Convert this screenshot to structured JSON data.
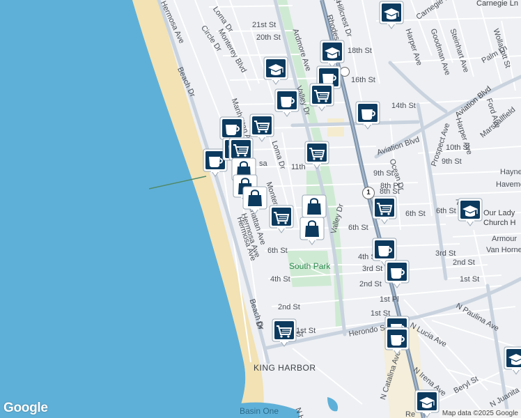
{
  "map": {
    "attribution": "Map data ©2025 Google",
    "logo": "Google",
    "colors": {
      "ocean": "#5fb0d8",
      "sand": "#f2e2b4",
      "land": "#eef0f3",
      "road_major": "#b7c6d8",
      "highway": "#7f95ad",
      "park": "#cfead3",
      "marker_fill": "#0c3a5e"
    },
    "labels": [
      {
        "text": "21st St"
      },
      {
        "text": "20th St"
      },
      {
        "text": "Loma Dr"
      },
      {
        "text": "Circle Dr"
      },
      {
        "text": "Monterey Blvd"
      },
      {
        "text": "Hermosa Ave"
      },
      {
        "text": "Beach Dr"
      },
      {
        "text": "Manhattan Ave"
      },
      {
        "text": "Ardmore Ave"
      },
      {
        "text": "Valley Dr"
      },
      {
        "text": "18th St"
      },
      {
        "text": "16th St"
      },
      {
        "text": "14th St"
      },
      {
        "text": "Rhodes St"
      },
      {
        "text": "Hillcrest Dr"
      },
      {
        "text": "21st St"
      },
      {
        "text": "Carnegie Ln"
      },
      {
        "text": "Carnegie Ln"
      },
      {
        "text": "Harper Ave"
      },
      {
        "text": "Goodman Ave"
      },
      {
        "text": "Steinhart Ave"
      },
      {
        "text": "Wollacott St"
      },
      {
        "text": "Palm Ln"
      },
      {
        "text": "Aviation Blvd"
      },
      {
        "text": "Ford Ave"
      },
      {
        "text": "Harper Ave"
      },
      {
        "text": "Marshallfield"
      },
      {
        "text": "Prospect Ave"
      },
      {
        "text": "10th St"
      },
      {
        "text": "9th St"
      },
      {
        "text": "Hayne"
      },
      {
        "text": "Havemeye"
      },
      {
        "text": "7th Pl"
      },
      {
        "text": "6th St"
      },
      {
        "text": "Our Lady"
      },
      {
        "text": "Church H"
      },
      {
        "text": "Armour"
      },
      {
        "text": "Van Horne"
      },
      {
        "text": "Aviation Blvd"
      },
      {
        "text": "Ocean Dr"
      },
      {
        "text": "9th St"
      },
      {
        "text": "8th Pl"
      },
      {
        "text": "8th St"
      },
      {
        "text": "11th"
      },
      {
        "text": "Loma Dr"
      },
      {
        "text": "Monterey Blvd"
      },
      {
        "text": "Manhattan Ave"
      },
      {
        "text": "Hermosa Ave"
      },
      {
        "text": "6th St"
      },
      {
        "text": "6th St"
      },
      {
        "text": "6th St"
      },
      {
        "text": "4th St"
      },
      {
        "text": "4th St"
      },
      {
        "text": "3rd St"
      },
      {
        "text": "3rd St"
      },
      {
        "text": "2nd St"
      },
      {
        "text": "2nd St"
      },
      {
        "text": "2nd St"
      },
      {
        "text": "1st St"
      },
      {
        "text": "1st Pl"
      },
      {
        "text": "1st St"
      },
      {
        "text": "1st St"
      },
      {
        "text": "Valley Dr"
      },
      {
        "text": "South Park"
      },
      {
        "text": "Beach Dr"
      },
      {
        "text": "Herondo St"
      },
      {
        "text": "N Paulina Ave"
      },
      {
        "text": "N Lucia Ave"
      },
      {
        "text": "N Irena Ave"
      },
      {
        "text": "N Juanita"
      },
      {
        "text": "Beryl St"
      },
      {
        "text": "N Catalina Ave"
      },
      {
        "text": "KING HARBOR"
      },
      {
        "text": "Basin One"
      },
      {
        "text": "N Ha"
      },
      {
        "text": "Hermosa Ave"
      },
      {
        "text": "sa"
      },
      {
        "text": "Re"
      },
      {
        "text": "Dr"
      },
      {
        "text": "St"
      }
    ],
    "markers": [
      {
        "kind": "school",
        "icon": "school-icon"
      },
      {
        "kind": "school",
        "icon": "school-icon"
      },
      {
        "kind": "school",
        "icon": "school-icon"
      },
      {
        "kind": "school",
        "icon": "school-icon"
      },
      {
        "kind": "school",
        "icon": "school-icon"
      },
      {
        "kind": "school",
        "icon": "school-icon"
      },
      {
        "kind": "cafe",
        "icon": "coffee-cup-icon"
      },
      {
        "kind": "cafe",
        "icon": "coffee-cup-icon"
      },
      {
        "kind": "cafe",
        "icon": "coffee-cup-icon"
      },
      {
        "kind": "cafe",
        "icon": "coffee-cup-icon"
      },
      {
        "kind": "cafe",
        "icon": "coffee-cup-icon"
      },
      {
        "kind": "cafe",
        "icon": "coffee-cup-icon"
      },
      {
        "kind": "cafe",
        "icon": "coffee-cup-icon"
      },
      {
        "kind": "cafe",
        "icon": "coffee-cup-icon"
      },
      {
        "kind": "cafe",
        "icon": "coffee-cup-icon"
      },
      {
        "kind": "cafe",
        "icon": "coffee-cup-icon"
      },
      {
        "kind": "grocery",
        "icon": "shopping-cart-icon"
      },
      {
        "kind": "grocery",
        "icon": "shopping-cart-icon"
      },
      {
        "kind": "grocery",
        "icon": "shopping-cart-icon"
      },
      {
        "kind": "grocery",
        "icon": "shopping-cart-icon"
      },
      {
        "kind": "grocery",
        "icon": "shopping-cart-icon"
      },
      {
        "kind": "grocery",
        "icon": "shopping-cart-icon"
      },
      {
        "kind": "grocery",
        "icon": "shopping-cart-icon"
      },
      {
        "kind": "shop",
        "icon": "shopping-bag-icon"
      },
      {
        "kind": "shop",
        "icon": "shopping-bag-icon"
      },
      {
        "kind": "shop",
        "icon": "shopping-bag-icon"
      },
      {
        "kind": "shop",
        "icon": "shopping-bag-icon"
      },
      {
        "kind": "shop",
        "icon": "shopping-bag-icon"
      }
    ],
    "highway_shield": "1"
  }
}
